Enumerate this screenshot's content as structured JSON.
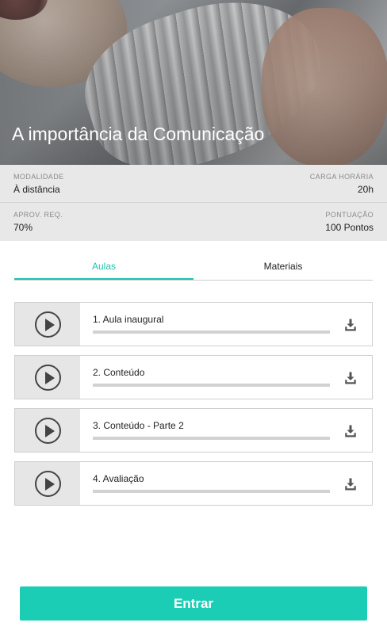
{
  "header": {
    "title": "A importância da Comunicação"
  },
  "info": {
    "modality_label": "MODALIDADE",
    "modality_value": "À distância",
    "workload_label": "CARGA HORÁRIA",
    "workload_value": "20h",
    "approval_label": "APROV. REQ.",
    "approval_value": "70%",
    "score_label": "PONTUAÇÃO",
    "score_value": "100 Pontos"
  },
  "tabs": [
    {
      "label": "Aulas",
      "active": true
    },
    {
      "label": "Materiais",
      "active": false
    }
  ],
  "lessons": [
    {
      "title": "1. Aula inaugural",
      "progress": 0,
      "icon": "play-circle-icon",
      "action_icon": "download-icon"
    },
    {
      "title": "2. Conteúdo",
      "progress": 0,
      "icon": "play-circle-icon",
      "action_icon": "download-icon"
    },
    {
      "title": "3. Conteúdo - Parte 2",
      "progress": 0,
      "icon": "play-circle-icon",
      "action_icon": "download-icon"
    },
    {
      "title": "4. Avaliação",
      "progress": 0,
      "icon": "play-circle-icon",
      "action_icon": "download-icon"
    }
  ],
  "footer": {
    "enter_label": "Entrar"
  },
  "colors": {
    "accent": "#1cc4ad",
    "button": "#1ccdb6",
    "info_background": "#e8e8e8"
  }
}
